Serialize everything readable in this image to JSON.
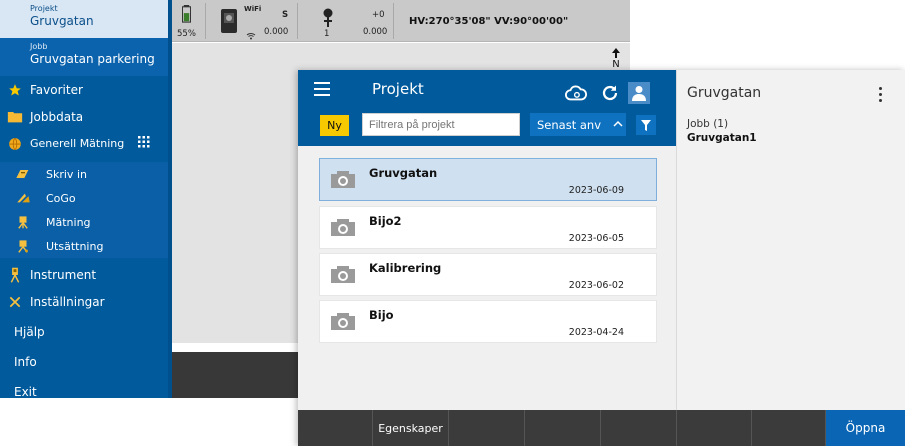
{
  "sidebar": {
    "project_caption": "Projekt",
    "project_name": "Gruvgatan",
    "job_caption": "Jobb",
    "job_name": "Gruvgatan parkering",
    "items": [
      {
        "label": "Favoriter"
      },
      {
        "label": "Jobbdata"
      },
      {
        "label": "Generell Mätning"
      },
      {
        "label": "Skriv in"
      },
      {
        "label": "CoGo"
      },
      {
        "label": "Mätning"
      },
      {
        "label": "Utsättning"
      },
      {
        "label": "Instrument"
      },
      {
        "label": "Inställningar"
      },
      {
        "label": "Hjälp"
      },
      {
        "label": "Info"
      },
      {
        "label": "Exit"
      }
    ]
  },
  "statusbar": {
    "battery_percent": "55%",
    "wifi_label": "WiFi",
    "inst_s": "S",
    "inst_value": "0.000",
    "target_height": "+0",
    "target_value": "0.000",
    "target_index": "1",
    "angles": "HV:270°35'08\" VV:90°00'00\"",
    "north": "N"
  },
  "dialog": {
    "title": "Projekt",
    "new_label": "Ny",
    "filter_placeholder": "Filtrera på projekt",
    "sort_label": "Senast anv",
    "projects": [
      {
        "name": "Gruvgatan",
        "date": "2023-06-09",
        "selected": true
      },
      {
        "name": "Bijo2",
        "date": "2023-06-05",
        "selected": false
      },
      {
        "name": "Kalibrering",
        "date": "2023-06-02",
        "selected": false
      },
      {
        "name": "Bijo",
        "date": "2023-04-24",
        "selected": false
      }
    ],
    "detail": {
      "title": "Gruvgatan",
      "job_count": "Jobb (1)",
      "job_name": "Gruvgatan1"
    },
    "footer": {
      "properties_label": "Egenskaper",
      "open_label": "Öppna"
    }
  },
  "colors": {
    "brand_blue": "#005a9c",
    "accent_yellow": "#f7c900",
    "selected_row": "#cfe0f0",
    "footer_dark": "#3b3b3b"
  }
}
